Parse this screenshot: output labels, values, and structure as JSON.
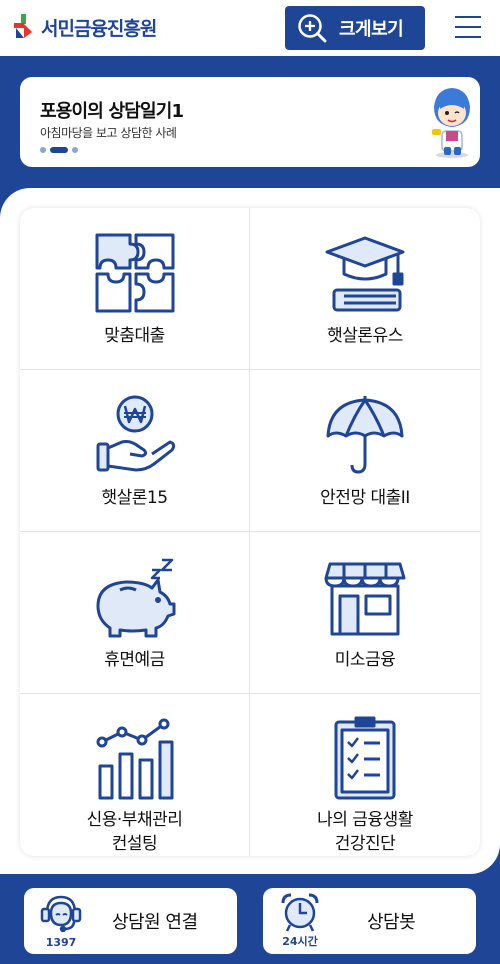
{
  "header": {
    "logo_text": "서민금융진흥원",
    "zoom_label": "크게보기"
  },
  "banner": {
    "title": "포용이의 상담일기1",
    "subtitle": "아침마당을 보고 상담한 사례",
    "slide_count": 3,
    "active_slide": 2
  },
  "menu": {
    "items": [
      {
        "label": "맞춤대출",
        "icon": "puzzle-icon"
      },
      {
        "label": "햇살론유스",
        "icon": "graduation-cap-icon"
      },
      {
        "label": "햇살론15",
        "icon": "won-hand-icon"
      },
      {
        "label": "안전망 대출II",
        "icon": "umbrella-icon"
      },
      {
        "label": "휴면예금",
        "icon": "piggy-bank-icon"
      },
      {
        "label": "미소금융",
        "icon": "store-icon"
      },
      {
        "label_line1": "신용·부채관리",
        "label_line2": "컨설팅",
        "icon": "growth-chart-icon"
      },
      {
        "label_line1": "나의 금융생활",
        "label_line2": "건강진단",
        "icon": "checklist-icon"
      }
    ]
  },
  "bottom": {
    "counselor_label": "상담원 연결",
    "counselor_number": "1397",
    "chatbot_label": "상담봇",
    "chatbot_caption": "24시간"
  },
  "colors": {
    "brand_blue": "#1f4597",
    "light_blue": "#dfe9f8"
  }
}
